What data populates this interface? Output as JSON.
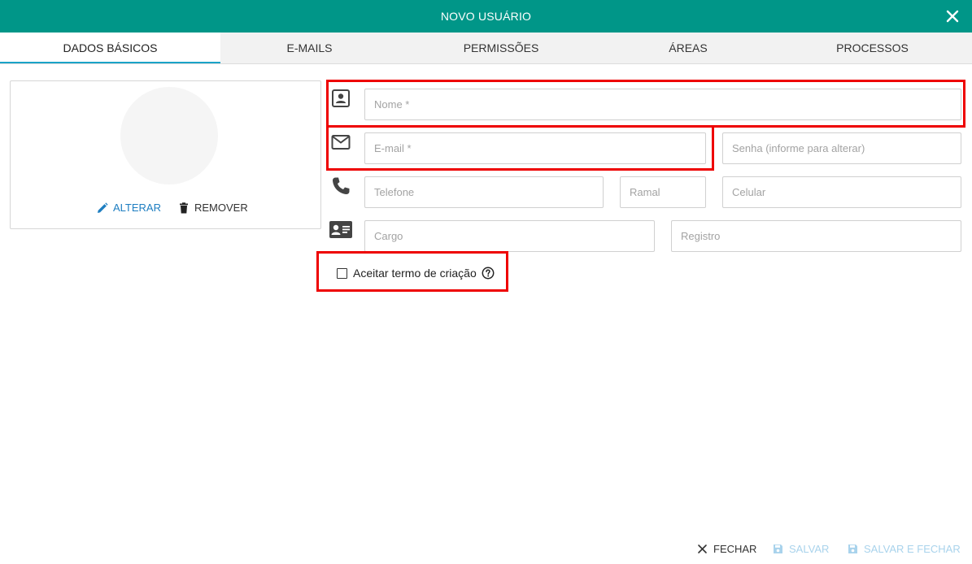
{
  "dialog": {
    "title": "NOVO USUÁRIO",
    "close_icon": "close-icon"
  },
  "tabs": [
    {
      "label": "DADOS BÁSICOS",
      "active": true
    },
    {
      "label": "E-MAILS",
      "active": false
    },
    {
      "label": "PERMISSÕES",
      "active": false
    },
    {
      "label": "ÁREAS",
      "active": false
    },
    {
      "label": "PROCESSOS",
      "active": false
    }
  ],
  "photo": {
    "alterar_label": "ALTERAR",
    "remover_label": "REMOVER"
  },
  "form": {
    "nome_placeholder": "Nome *",
    "email_placeholder": "E-mail *",
    "senha_placeholder": "Senha (informe para alterar)",
    "telefone_placeholder": "Telefone",
    "ramal_placeholder": "Ramal",
    "celular_placeholder": "Celular",
    "cargo_placeholder": "Cargo",
    "registro_placeholder": "Registro",
    "termo_label": "Aceitar termo de criação",
    "termo_checked": false
  },
  "footer": {
    "fechar_label": "FECHAR",
    "salvar_label": "SALVAR",
    "salvar_fechar_label": "SALVAR E FECHAR"
  },
  "colors": {
    "header": "#009688",
    "active_tab_underline": "#1aa3c8",
    "link_blue": "#1e7ec1",
    "disabled_blue": "#a9d3ec",
    "highlight_red": "#ee0000"
  }
}
